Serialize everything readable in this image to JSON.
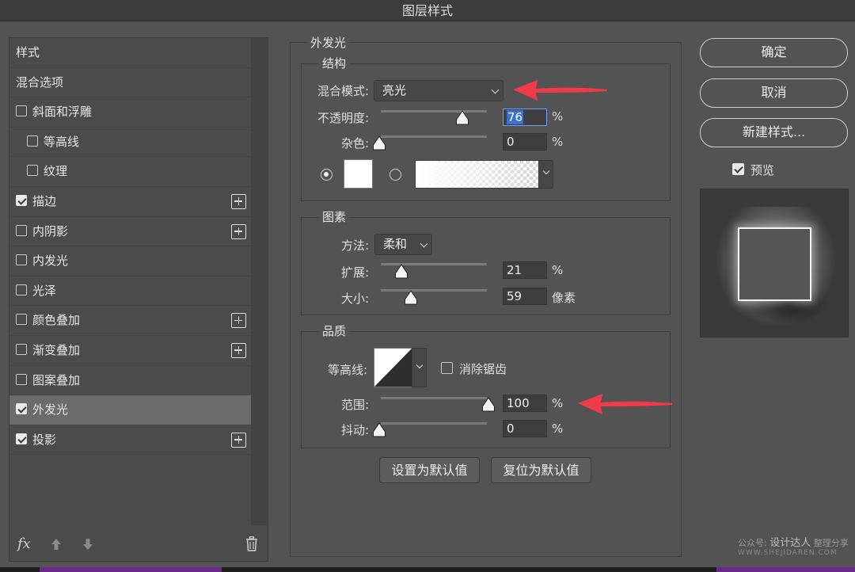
{
  "window": {
    "title": "图层样式"
  },
  "styles_list": {
    "items": [
      {
        "label": "样式",
        "checkbox": null,
        "indent": false,
        "selected": false,
        "plus": false
      },
      {
        "label": "混合选项",
        "checkbox": null,
        "indent": false,
        "selected": false,
        "plus": false
      },
      {
        "label": "斜面和浮雕",
        "checkbox": false,
        "indent": false,
        "selected": false,
        "plus": false
      },
      {
        "label": "等高线",
        "checkbox": false,
        "indent": true,
        "selected": false,
        "plus": false
      },
      {
        "label": "纹理",
        "checkbox": false,
        "indent": true,
        "selected": false,
        "plus": false
      },
      {
        "label": "描边",
        "checkbox": true,
        "indent": false,
        "selected": false,
        "plus": true
      },
      {
        "label": "内阴影",
        "checkbox": false,
        "indent": false,
        "selected": false,
        "plus": true
      },
      {
        "label": "内发光",
        "checkbox": false,
        "indent": false,
        "selected": false,
        "plus": false
      },
      {
        "label": "光泽",
        "checkbox": false,
        "indent": false,
        "selected": false,
        "plus": false
      },
      {
        "label": "颜色叠加",
        "checkbox": false,
        "indent": false,
        "selected": false,
        "plus": true
      },
      {
        "label": "渐变叠加",
        "checkbox": false,
        "indent": false,
        "selected": false,
        "plus": true
      },
      {
        "label": "图案叠加",
        "checkbox": false,
        "indent": false,
        "selected": false,
        "plus": false
      },
      {
        "label": "外发光",
        "checkbox": true,
        "indent": false,
        "selected": true,
        "plus": false
      },
      {
        "label": "投影",
        "checkbox": true,
        "indent": false,
        "selected": false,
        "plus": true
      }
    ],
    "footer": {
      "fx_label": "fx",
      "icons": [
        "fx-icon",
        "arrow-up-icon",
        "arrow-down-icon",
        "trash-icon"
      ]
    }
  },
  "outer_glow": {
    "title": "外发光",
    "structure": {
      "title": "结构",
      "blend_mode_label": "混合模式:",
      "blend_mode_value": "亮光",
      "opacity_label": "不透明度:",
      "opacity_value": "76",
      "opacity_unit": "%",
      "noise_label": "杂色:",
      "noise_value": "0",
      "noise_unit": "%",
      "color_radio_selected": "solid",
      "solid_color": "#ffffff"
    },
    "elements": {
      "title": "图素",
      "technique_label": "方法:",
      "technique_value": "柔和",
      "spread_label": "扩展:",
      "spread_value": "21",
      "spread_unit": "%",
      "size_label": "大小:",
      "size_value": "59",
      "size_unit": "像素"
    },
    "quality": {
      "title": "品质",
      "contour_label": "等高线:",
      "anti_alias_label": "消除锯齿",
      "anti_alias_checked": false,
      "range_label": "范围:",
      "range_value": "100",
      "range_unit": "%",
      "jitter_label": "抖动:",
      "jitter_value": "0",
      "jitter_unit": "%"
    },
    "buttons": {
      "make_default": "设置为默认值",
      "reset_default": "复位为默认值"
    }
  },
  "actions": {
    "ok": "确定",
    "cancel": "取消",
    "new_style": "新建样式...",
    "preview_label": "预览",
    "preview_checked": true
  },
  "watermark": {
    "line1_prefix": "公众号:",
    "line1_brand": "设计达人",
    "line1_suffix": "整理分享",
    "line2": "WWW.SHEJIDAREN.COM"
  },
  "colors": {
    "annotation_arrow": "#f03a4a",
    "selection": "#3d6fd0",
    "panel_bg": "#535353"
  }
}
